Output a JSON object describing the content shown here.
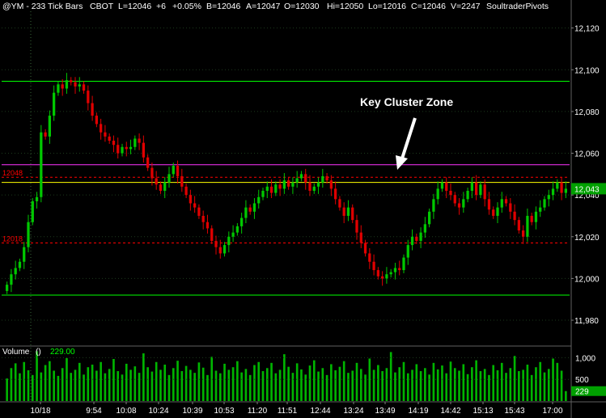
{
  "header": {
    "symbol": "@YM - 233 Tick Bars",
    "exchange": "CBOT",
    "last": "L=12046",
    "change": "+6",
    "change_pct": "+0.05%",
    "bid": "B=12046",
    "ask": "A=12047",
    "open": "O=12030",
    "high": "Hi=12050",
    "low": "Lo=12016",
    "close": "C=12046",
    "volume": "V=2247",
    "study": "SoultraderPivots"
  },
  "colors": {
    "background": "#000000",
    "up_candle": "#00c800",
    "down_candle": "#e00000",
    "grid": "#1d3a1d",
    "axis_text": "#ffffff",
    "green_level": "#00ff00",
    "magenta_level": "#ff33ff",
    "yellow_level": "#ffff00",
    "red_dashed": "#ff0000",
    "volume_bar": "#00b400",
    "price_label_bg": "#00a000"
  },
  "annotation": {
    "text": "Key Cluster Zone"
  },
  "chart_data": [
    {
      "type": "candlestick",
      "title": "",
      "y_ticks": [
        11980,
        12000,
        12020,
        12040,
        12060,
        12080,
        12100,
        12120
      ],
      "y_tick_labels": [
        "11,980",
        "12,000",
        "12,020",
        "12,040",
        "12,060",
        "12,080",
        "12,100",
        "12,120"
      ],
      "ylim": [
        11968,
        12128
      ],
      "x_tick_labels": [
        "10/18",
        "9:54",
        "10:08",
        "10:24",
        "10:39",
        "10:53",
        "11:20",
        "11:51",
        "12:44",
        "13:24",
        "13:49",
        "14:19",
        "14:42",
        "15:13",
        "15:43",
        "17:00"
      ],
      "levels": [
        {
          "price": 12094.5,
          "style": "solid",
          "color": "green"
        },
        {
          "price": 12054.5,
          "style": "solid",
          "color": "magenta"
        },
        {
          "price": 12048.5,
          "style": "dashed",
          "color": "red"
        },
        {
          "price": 12046,
          "style": "solid",
          "color": "yellow"
        },
        {
          "price": 12017,
          "style": "dashed",
          "color": "red"
        },
        {
          "price": 11992,
          "style": "solid",
          "color": "green"
        }
      ],
      "level_labels": [
        {
          "text": "12048",
          "price": 12048.5
        },
        {
          "text": "12018",
          "price": 12017
        }
      ],
      "current_price_label": "12,043",
      "current_price": 12043,
      "close_series": [
        11997,
        12002,
        12005,
        12008,
        12015,
        12027,
        12037,
        12039,
        12070,
        12068,
        12078,
        12089,
        12093,
        12091,
        12095,
        12094,
        12092,
        12093,
        12090,
        12084,
        12078,
        12074,
        12070,
        12068,
        12066,
        12064,
        12060,
        12063,
        12062,
        12063,
        12067,
        12065,
        12058,
        12053,
        12048,
        12045,
        12042,
        12046,
        12050,
        12054,
        12049,
        12044,
        12040,
        12036,
        12034,
        12030,
        12027,
        12024,
        12018,
        12015,
        12012,
        12016,
        12020,
        12022,
        12025,
        12029,
        12034,
        12032,
        12036,
        12039,
        12042,
        12044,
        12041,
        12045,
        12043,
        12047,
        12044,
        12046,
        12048,
        12050,
        12046,
        12042,
        12044,
        12046,
        12049,
        12047,
        12043,
        12038,
        12034,
        12030,
        12034,
        12028,
        12022,
        12017,
        12012,
        12008,
        12004,
        12001,
        12000,
        12002,
        12003,
        12005,
        12004,
        12010,
        12016,
        12020,
        12018,
        12022,
        12026,
        12032,
        12038,
        12043,
        12046,
        12042,
        12040,
        12036,
        12034,
        12038,
        12042,
        12046,
        12040,
        12045,
        12038,
        12033,
        12030,
        12034,
        12038,
        12036,
        12032,
        12028,
        12023,
        12020,
        12030,
        12027,
        12032,
        12034,
        12038,
        12040,
        12043,
        12046,
        12041,
        12043
      ]
    },
    {
      "type": "bar",
      "title": "Volume ()",
      "label": "Volume",
      "unit_label": "()",
      "last_value": "229.00",
      "y_ticks": [
        500,
        1000
      ],
      "y_tick_labels": [
        "500",
        "1,000"
      ],
      "ylim": [
        0,
        1250
      ],
      "current_value_label": "229",
      "current_value": 229,
      "volume_profile": [
        520,
        760,
        870,
        640,
        900,
        710,
        600,
        1150,
        660,
        830,
        920,
        700,
        580,
        760,
        990,
        650,
        720,
        880,
        610,
        780,
        840,
        700,
        900,
        640,
        740,
        970,
        690,
        610,
        860,
        720,
        800,
        650,
        1100,
        780,
        680,
        900,
        720,
        840,
        600,
        760,
        930,
        690,
        810,
        720,
        650,
        890,
        770,
        600,
        1020,
        700,
        640,
        860,
        720,
        780,
        920,
        660,
        740,
        600,
        830,
        900,
        690,
        760,
        880,
        640,
        720,
        1080,
        790,
        650,
        870,
        730,
        610,
        820,
        940,
        680,
        760,
        600,
        850,
        710,
        790,
        920,
        650,
        700,
        880,
        740,
        610,
        980,
        720,
        830,
        690,
        760,
        1130,
        660,
        780,
        900,
        640,
        720,
        850,
        690,
        760,
        610,
        880,
        730,
        820,
        640,
        910,
        760,
        700,
        850,
        620,
        780,
        940,
        690,
        740,
        600,
        830,
        710,
        880,
        650,
        760,
        1040,
        690,
        720,
        840,
        600,
        780,
        900,
        660,
        740,
        980,
        880,
        700,
        229
      ]
    }
  ]
}
